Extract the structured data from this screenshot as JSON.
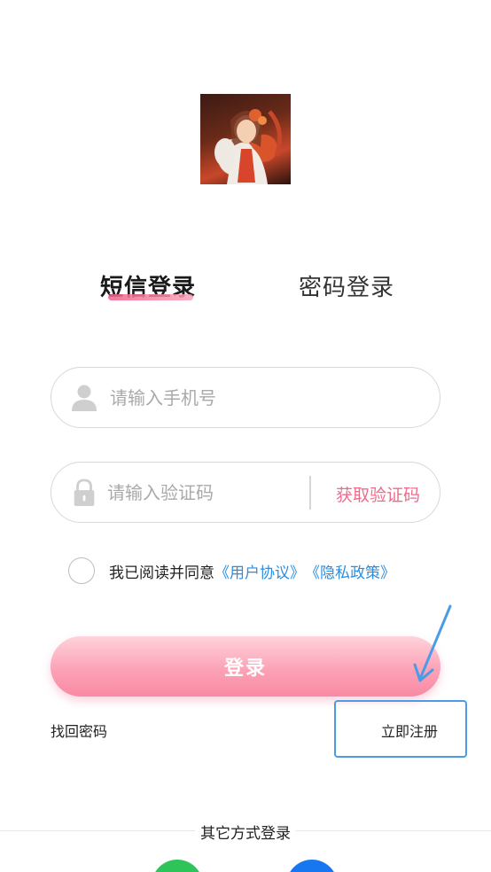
{
  "tabs": {
    "sms_login": "短信登录",
    "password_login": "密码登录"
  },
  "phone": {
    "placeholder": "请输入手机号",
    "value": ""
  },
  "code": {
    "placeholder": "请输入验证码",
    "value": "",
    "get_code_label": "获取验证码"
  },
  "agreement": {
    "text": "我已阅读并同意",
    "user_agreement": "《用户协议》",
    "privacy_policy": "《隐私政策》",
    "checked": false
  },
  "login_button": "登录",
  "links": {
    "forgot_password": "找回密码",
    "register": "立即注册"
  },
  "other_login": {
    "title": "其它方式登录",
    "providers": [
      "wechat-icon",
      "qq-icon"
    ]
  },
  "colors": {
    "accent_pink": "#ef6b8e",
    "link_blue": "#2b8de0",
    "annotation_blue": "#4c9be6"
  }
}
